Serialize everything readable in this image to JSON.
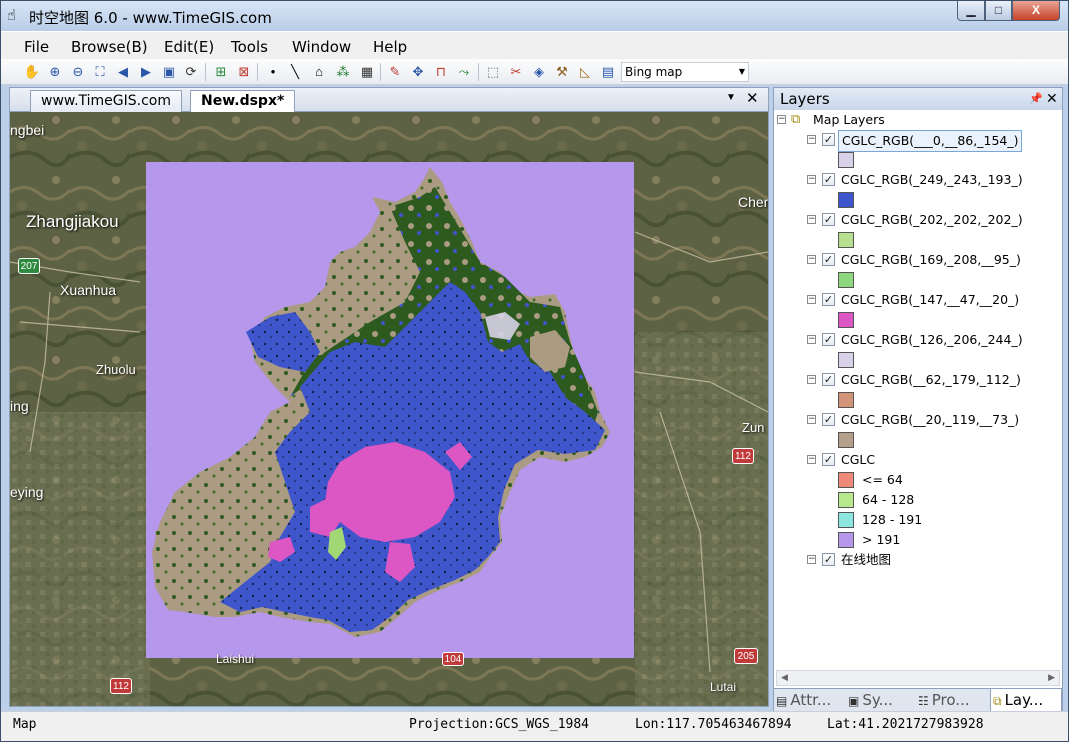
{
  "window": {
    "title": "时空地图 6.0 - www.TimeGIS.com",
    "min_label": "▁",
    "max_label": "□",
    "close_label": "X"
  },
  "menu": [
    "File",
    "Browse(B)",
    "Edit(E)",
    "Tools",
    "Window",
    "Help"
  ],
  "toolbar": {
    "basemap_combo": "Bing map",
    "icons": [
      "pan-icon",
      "zoom-in-icon",
      "zoom-out-icon",
      "full-extent-icon",
      "back-icon",
      "forward-icon",
      "zoom-layer-icon",
      "refresh-icon",
      "add-layer-icon",
      "remove-layer-icon",
      "point-icon",
      "line-icon",
      "polygon-icon",
      "multipoint-icon",
      "grid-icon",
      "edit-icon",
      "move-icon",
      "magnet-icon",
      "snap-icon",
      "select-icon",
      "delete-icon",
      "identify-icon",
      "hammer-icon",
      "measure-icon",
      "table-icon"
    ]
  },
  "document": {
    "tabs": [
      "www.TimeGIS.com",
      "New.dspx*"
    ],
    "active_tab": 1
  },
  "map": {
    "place_labels": [
      "Zhangjiakou",
      "Xuanhua",
      "Zhuolu",
      "Chen",
      "Zun",
      "ngbei",
      "ing",
      "eying",
      "Laishui",
      "Lutai"
    ],
    "road_shields": [
      "207",
      "112",
      "112",
      "104",
      "205"
    ],
    "raster_colors": {
      "background": "#b597ec",
      "forest": "#2d5a1e",
      "shrub": "#aa9b82",
      "water": "#3f55cc",
      "urban": "#dc57c4",
      "grass": "#a2d776"
    }
  },
  "layers_panel": {
    "title": "Layers",
    "root": "Map Layers",
    "layers": [
      {
        "name": "CGLC_RGB(___0,__86,_154_)",
        "color": "#d7d2e6",
        "selected": true
      },
      {
        "name": "CGLC_RGB(_249,_243,_193_)",
        "color": "#3f55cc"
      },
      {
        "name": "CGLC_RGB(_202,_202,_202_)",
        "color": "#b6df8f"
      },
      {
        "name": "CGLC_RGB(_169,_208,__95_)",
        "color": "#8fd680"
      },
      {
        "name": "CGLC_RGB(_147,__47,__20_)",
        "color": "#dc57c4"
      },
      {
        "name": "CGLC_RGB(_126,_206,_244_)",
        "color": "#d8d2e6"
      },
      {
        "name": "CGLC_RGB(__62,_179,_112_)",
        "color": "#d3957a"
      },
      {
        "name": "CGLC_RGB(__20,_119,__73_)",
        "color": "#b4a08c"
      }
    ],
    "cglc": {
      "name": "CGLC",
      "classes": [
        {
          "label": "<= 64",
          "color": "#ef8a7b"
        },
        {
          "label": "64 - 128",
          "color": "#b7e88c"
        },
        {
          "label": "128 - 191",
          "color": "#8ee6e0"
        },
        {
          "label": "> 191",
          "color": "#b597ec"
        }
      ]
    },
    "online_map": "在线地图",
    "tabs": [
      "Attr...",
      "Sy...",
      "Pro...",
      "Lay..."
    ],
    "active_tab": 3
  },
  "status": {
    "left": "Map",
    "projection": "Projection:GCS_WGS_1984",
    "lon": "Lon:117.705463467894",
    "lat": "Lat:41.2021727983928"
  }
}
